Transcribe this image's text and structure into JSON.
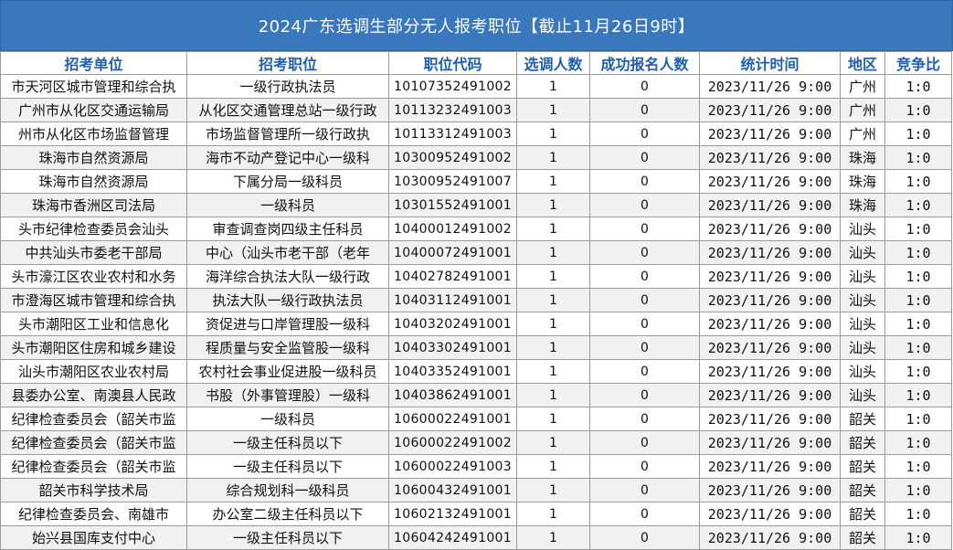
{
  "title": "2024广东选调生部分无人报考职位【截止11月26日9时】",
  "colors": {
    "header_bg": "#3a78bd",
    "header_text": "#ffffff",
    "column_header_text": "#1f5fae"
  },
  "columns": [
    "招考单位",
    "招考职位",
    "职位代码",
    "选调人数",
    "成功报名人数",
    "统计时间",
    "地区",
    "竞争比"
  ],
  "rows": [
    [
      "市天河区城市管理和综合执",
      "一级行政执法员",
      "10107352491002",
      "1",
      "0",
      "2023/11/26 9:00",
      "广州",
      "1:0"
    ],
    [
      "广州市从化区交通运输局",
      "从化区交通管理总站一级行政",
      "10113232491003",
      "1",
      "0",
      "2023/11/26 9:00",
      "广州",
      "1:0"
    ],
    [
      "州市从化区市场监督管理",
      "市场监督管理所一级行政执",
      "10113312491003",
      "1",
      "0",
      "2023/11/26 9:00",
      "广州",
      "1:0"
    ],
    [
      "珠海市自然资源局",
      "海市不动产登记中心一级科",
      "10300952491002",
      "1",
      "0",
      "2023/11/26 9:00",
      "珠海",
      "1:0"
    ],
    [
      "珠海市自然资源局",
      "下属分局一级科员",
      "10300952491007",
      "1",
      "0",
      "2023/11/26 9:00",
      "珠海",
      "1:0"
    ],
    [
      "珠海市香洲区司法局",
      "一级科员",
      "10301552491001",
      "1",
      "0",
      "2023/11/26 9:00",
      "珠海",
      "1:0"
    ],
    [
      "头市纪律检查委员会汕头",
      "审查调查岗四级主任科员",
      "10400012491002",
      "1",
      "0",
      "2023/11/26 9:00",
      "汕头",
      "1:0"
    ],
    [
      "中共汕头市委老干部局",
      "中心（汕头市老干部（老年",
      "10400072491001",
      "1",
      "0",
      "2023/11/26 9:00",
      "汕头",
      "1:0"
    ],
    [
      "头市濠江区农业农村和水务",
      "海洋综合执法大队一级行政",
      "10402782491001",
      "1",
      "0",
      "2023/11/26 9:00",
      "汕头",
      "1:0"
    ],
    [
      "市澄海区城市管理和综合执",
      "执法大队一级行政执法员",
      "10403112491001",
      "1",
      "0",
      "2023/11/26 9:00",
      "汕头",
      "1:0"
    ],
    [
      "头市潮阳区工业和信息化",
      "资促进与口岸管理股一级科",
      "10403202491001",
      "1",
      "0",
      "2023/11/26 9:00",
      "汕头",
      "1:0"
    ],
    [
      "头市潮阳区住房和城乡建设",
      "程质量与安全监管股一级科",
      "10403302491001",
      "1",
      "0",
      "2023/11/26 9:00",
      "汕头",
      "1:0"
    ],
    [
      "汕头市潮阳区农业农村局",
      "农村社会事业促进股一级科员",
      "10403352491001",
      "1",
      "0",
      "2023/11/26 9:00",
      "汕头",
      "1:0"
    ],
    [
      "县委办公室、南澳县人民政",
      "书股（外事管理股）一级科",
      "10403862491001",
      "1",
      "0",
      "2023/11/26 9:00",
      "汕头",
      "1:0"
    ],
    [
      "纪律检查委员会（韶关市监",
      "一级科员",
      "10600022491001",
      "1",
      "0",
      "2023/11/26 9:00",
      "韶关",
      "1:0"
    ],
    [
      "纪律检查委员会（韶关市监",
      "一级主任科员以下",
      "10600022491002",
      "1",
      "0",
      "2023/11/26 9:00",
      "韶关",
      "1:0"
    ],
    [
      "纪律检查委员会（韶关市监",
      "一级主任科员以下",
      "10600022491003",
      "1",
      "0",
      "2023/11/26 9:00",
      "韶关",
      "1:0"
    ],
    [
      "韶关市科学技术局",
      "综合规划科一级科员",
      "10600432491001",
      "1",
      "0",
      "2023/11/26 9:00",
      "韶关",
      "1:0"
    ],
    [
      "纪律检查委员会、南雄市",
      "办公室二级主任科员以下",
      "10602132491001",
      "1",
      "0",
      "2023/11/26 9:00",
      "韶关",
      "1:0"
    ],
    [
      "始兴县国库支付中心",
      "一级主任科员以下",
      "10604242491001",
      "1",
      "0",
      "2023/11/26 9:00",
      "韶关",
      "1:0"
    ]
  ]
}
